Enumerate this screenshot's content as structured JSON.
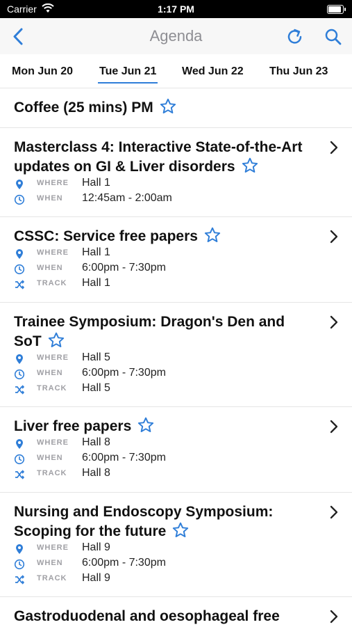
{
  "status": {
    "carrier": "Carrier",
    "time": "1:17 PM"
  },
  "nav": {
    "title": "Agenda"
  },
  "tabs": [
    {
      "label": "Mon Jun 20",
      "active": false
    },
    {
      "label": "Tue Jun 21",
      "active": true
    },
    {
      "label": "Wed Jun 22",
      "active": false
    },
    {
      "label": "Thu Jun 23",
      "active": false
    }
  ],
  "labels": {
    "where": "WHERE",
    "when": "WHEN",
    "track": "TRACK"
  },
  "sessions": [
    {
      "title": "Coffee (25 mins) PM"
    },
    {
      "title_line1": "Masterclass 4: Interactive State-of-the-Art",
      "title_line2": "updates on GI & Liver disorders",
      "where": "Hall 1",
      "when": "12:45am - 2:00am"
    },
    {
      "title": "CSSC: Service free papers",
      "where": "Hall 1",
      "when": "6:00pm - 7:30pm",
      "track": "Hall 1"
    },
    {
      "title_line1": "Trainee Symposium: Dragon's Den and",
      "title_line2": "SoT",
      "where": "Hall 5",
      "when": "6:00pm - 7:30pm",
      "track": "Hall 5"
    },
    {
      "title": "Liver free papers",
      "where": "Hall 8",
      "when": "6:00pm - 7:30pm",
      "track": "Hall 8"
    },
    {
      "title_line1": "Nursing and Endoscopy Symposium:",
      "title_line2": "Scoping for the future",
      "where": "Hall 9",
      "when": "6:00pm - 7:30pm",
      "track": "Hall 9"
    },
    {
      "title": "Gastroduodenal and oesophageal free"
    }
  ],
  "colors": {
    "accent": "#2f7ed8",
    "label": "#a0a0a5"
  }
}
